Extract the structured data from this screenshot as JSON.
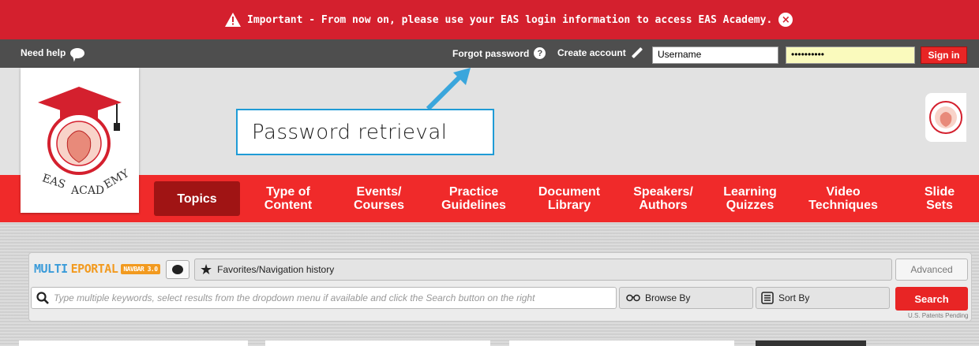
{
  "alert": {
    "text": "Important - From now on, please use your EAS login information to access EAS Academy.",
    "close_symbol": "×"
  },
  "topbar": {
    "need_help": "Need help",
    "forgot_password": "Forgot password",
    "create_account": "Create account",
    "username_value": "Username",
    "password_value": "••••••••••",
    "sign_in": "Sign in"
  },
  "header": {
    "callout_text": "Password retrieval"
  },
  "nav": {
    "items": [
      {
        "line1": "Topics",
        "line2": ""
      },
      {
        "line1": "Type of",
        "line2": "Content"
      },
      {
        "line1": "Events/",
        "line2": "Courses"
      },
      {
        "line1": "Practice",
        "line2": "Guidelines"
      },
      {
        "line1": "Document",
        "line2": "Library"
      },
      {
        "line1": "Speakers/",
        "line2": "Authors"
      },
      {
        "line1": "Learning",
        "line2": "Quizzes"
      },
      {
        "line1": "Video",
        "line2": "Techniques"
      },
      {
        "line1": "Slide",
        "line2": "Sets"
      }
    ]
  },
  "search": {
    "brand_multi": "MULTI",
    "brand_eportal": "EPORTAL",
    "brand_navbar": "NAVBAR 3.0",
    "favorites": "Favorites/Navigation history",
    "advanced": "Advanced",
    "placeholder": "Type multiple keywords, select results from the dropdown menu if available and click the Search button on the right",
    "browse_by": "Browse By",
    "sort_by": "Sort By",
    "search_button": "Search",
    "patents": "U.S. Patents Pending"
  },
  "colors": {
    "alert_red": "#d4202e",
    "nav_red": "#f02a2a",
    "nav_active": "#a01414",
    "callout_border": "#1f9bd6",
    "brand_blue": "#3a9bd9",
    "brand_orange": "#f29a1f"
  },
  "icons": [
    "warning-icon",
    "close-icon",
    "chat-bubble-icon",
    "question-icon",
    "pencil-icon",
    "star-icon",
    "search-icon",
    "glasses-icon",
    "sort-icon"
  ]
}
